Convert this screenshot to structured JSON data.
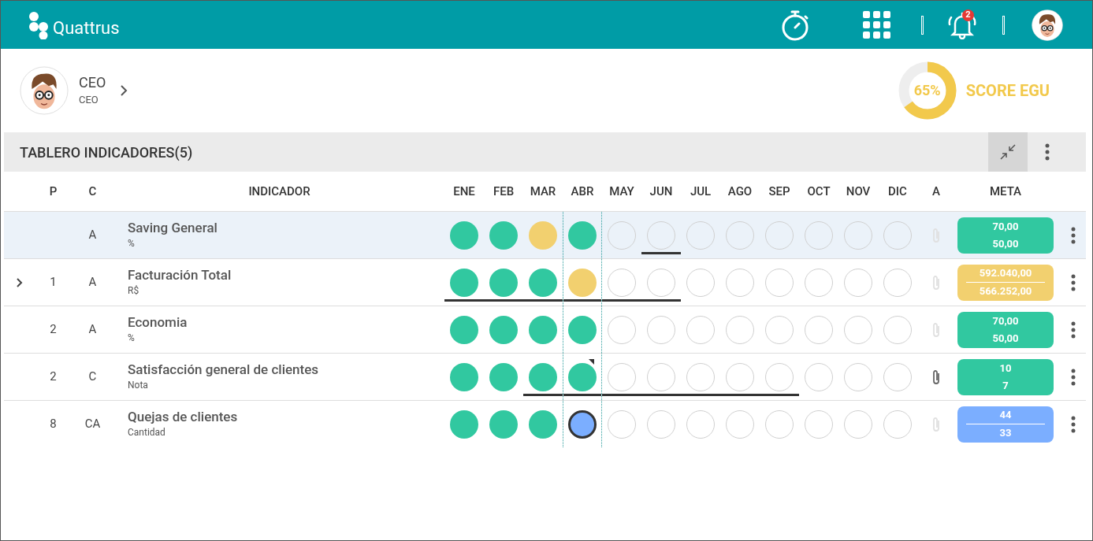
{
  "app": {
    "logo_text": "Quattrus",
    "notification_count": "2"
  },
  "profile": {
    "name": "CEO",
    "role": "CEO"
  },
  "score": {
    "value": "65%",
    "label": "SCORE EGU",
    "level": 0.65
  },
  "panel": {
    "title": "TABLERO INDICADORES(5)"
  },
  "table": {
    "columns": [
      "P",
      "C",
      "INDICADOR",
      "ENE",
      "FEB",
      "MAR",
      "ABR",
      "MAY",
      "JUN",
      "JUL",
      "AGO",
      "SEP",
      "OCT",
      "NOV",
      "DIC",
      "A",
      "META"
    ],
    "rows": [
      {
        "selected": true,
        "expandable": false,
        "p": "",
        "c": "A",
        "name": "Saving General",
        "unit": "%",
        "attachment": false,
        "meta": {
          "kind": "good",
          "divider": false,
          "target": "70,00",
          "actual": "50,00"
        },
        "cells": [
          {
            "kind": "good",
            "underlined": false,
            "flagged": false
          },
          {
            "kind": "good",
            "underlined": false,
            "flagged": false
          },
          {
            "kind": "warn",
            "underlined": false,
            "flagged": false
          },
          {
            "kind": "good",
            "underlined": false,
            "flagged": false
          },
          {
            "kind": "empty",
            "underlined": false,
            "flagged": false
          },
          {
            "kind": "empty",
            "underlined": true,
            "flagged": false
          },
          {
            "kind": "empty",
            "underlined": false,
            "flagged": false
          },
          {
            "kind": "empty",
            "underlined": false,
            "flagged": false
          },
          {
            "kind": "empty",
            "underlined": false,
            "flagged": false
          },
          {
            "kind": "empty",
            "underlined": false,
            "flagged": false
          },
          {
            "kind": "empty",
            "underlined": false,
            "flagged": false
          },
          {
            "kind": "empty",
            "underlined": false,
            "flagged": false
          }
        ]
      },
      {
        "selected": false,
        "expandable": true,
        "p": "1",
        "c": "A",
        "name": "Facturación Total",
        "unit": "R$",
        "attachment": false,
        "meta": {
          "kind": "warn",
          "divider": true,
          "target": "592.040,00",
          "actual": "566.252,00"
        },
        "cells": [
          {
            "kind": "good",
            "underlined": true,
            "flagged": false
          },
          {
            "kind": "good",
            "underlined": true,
            "flagged": false
          },
          {
            "kind": "good",
            "underlined": true,
            "flagged": false
          },
          {
            "kind": "warn",
            "underlined": true,
            "flagged": false
          },
          {
            "kind": "empty",
            "underlined": true,
            "flagged": false
          },
          {
            "kind": "empty",
            "underlined": true,
            "flagged": false
          },
          {
            "kind": "empty",
            "underlined": false,
            "flagged": false
          },
          {
            "kind": "empty",
            "underlined": false,
            "flagged": false
          },
          {
            "kind": "empty",
            "underlined": false,
            "flagged": false
          },
          {
            "kind": "empty",
            "underlined": false,
            "flagged": false
          },
          {
            "kind": "empty",
            "underlined": false,
            "flagged": false
          },
          {
            "kind": "empty",
            "underlined": false,
            "flagged": false
          }
        ]
      },
      {
        "selected": false,
        "expandable": false,
        "p": "2",
        "c": "A",
        "name": "Economia",
        "unit": "%",
        "attachment": false,
        "meta": {
          "kind": "good",
          "divider": false,
          "target": "70,00",
          "actual": "50,00"
        },
        "cells": [
          {
            "kind": "good",
            "underlined": false,
            "flagged": false
          },
          {
            "kind": "good",
            "underlined": false,
            "flagged": false
          },
          {
            "kind": "good",
            "underlined": false,
            "flagged": false
          },
          {
            "kind": "good",
            "underlined": false,
            "flagged": false
          },
          {
            "kind": "empty",
            "underlined": false,
            "flagged": false
          },
          {
            "kind": "empty",
            "underlined": false,
            "flagged": false
          },
          {
            "kind": "empty",
            "underlined": false,
            "flagged": false
          },
          {
            "kind": "empty",
            "underlined": false,
            "flagged": false
          },
          {
            "kind": "empty",
            "underlined": false,
            "flagged": false
          },
          {
            "kind": "empty",
            "underlined": false,
            "flagged": false
          },
          {
            "kind": "empty",
            "underlined": false,
            "flagged": false
          },
          {
            "kind": "empty",
            "underlined": false,
            "flagged": false
          }
        ]
      },
      {
        "selected": false,
        "expandable": false,
        "p": "2",
        "c": "C",
        "name": "Satisfacción general de clientes",
        "unit": "Nota",
        "attachment": true,
        "meta": {
          "kind": "good",
          "divider": false,
          "target": "10",
          "actual": "7"
        },
        "cells": [
          {
            "kind": "good",
            "underlined": false,
            "flagged": false
          },
          {
            "kind": "good",
            "underlined": false,
            "flagged": false
          },
          {
            "kind": "good",
            "underlined": true,
            "flagged": false
          },
          {
            "kind": "good",
            "underlined": true,
            "flagged": true
          },
          {
            "kind": "empty",
            "underlined": true,
            "flagged": false
          },
          {
            "kind": "empty",
            "underlined": true,
            "flagged": false
          },
          {
            "kind": "empty",
            "underlined": true,
            "flagged": false
          },
          {
            "kind": "empty",
            "underlined": true,
            "flagged": false
          },
          {
            "kind": "empty",
            "underlined": true,
            "flagged": false
          },
          {
            "kind": "empty",
            "underlined": false,
            "flagged": false
          },
          {
            "kind": "empty",
            "underlined": false,
            "flagged": false
          },
          {
            "kind": "empty",
            "underlined": false,
            "flagged": false
          }
        ]
      },
      {
        "selected": false,
        "expandable": false,
        "p": "8",
        "c": "CA",
        "name": "Quejas de clientes",
        "unit": "Cantidad",
        "attachment": false,
        "meta": {
          "kind": "info",
          "divider": true,
          "target": "44",
          "actual": "33"
        },
        "cells": [
          {
            "kind": "good",
            "underlined": false,
            "flagged": false
          },
          {
            "kind": "good",
            "underlined": false,
            "flagged": false
          },
          {
            "kind": "good",
            "underlined": false,
            "flagged": false
          },
          {
            "kind": "current",
            "underlined": false,
            "flagged": false
          },
          {
            "kind": "empty",
            "underlined": false,
            "flagged": false
          },
          {
            "kind": "empty",
            "underlined": false,
            "flagged": false
          },
          {
            "kind": "empty",
            "underlined": false,
            "flagged": false
          },
          {
            "kind": "empty",
            "underlined": false,
            "flagged": false
          },
          {
            "kind": "empty",
            "underlined": false,
            "flagged": false
          },
          {
            "kind": "empty",
            "underlined": false,
            "flagged": false
          },
          {
            "kind": "empty",
            "underlined": false,
            "flagged": false
          },
          {
            "kind": "empty",
            "underlined": false,
            "flagged": false
          }
        ]
      }
    ]
  }
}
